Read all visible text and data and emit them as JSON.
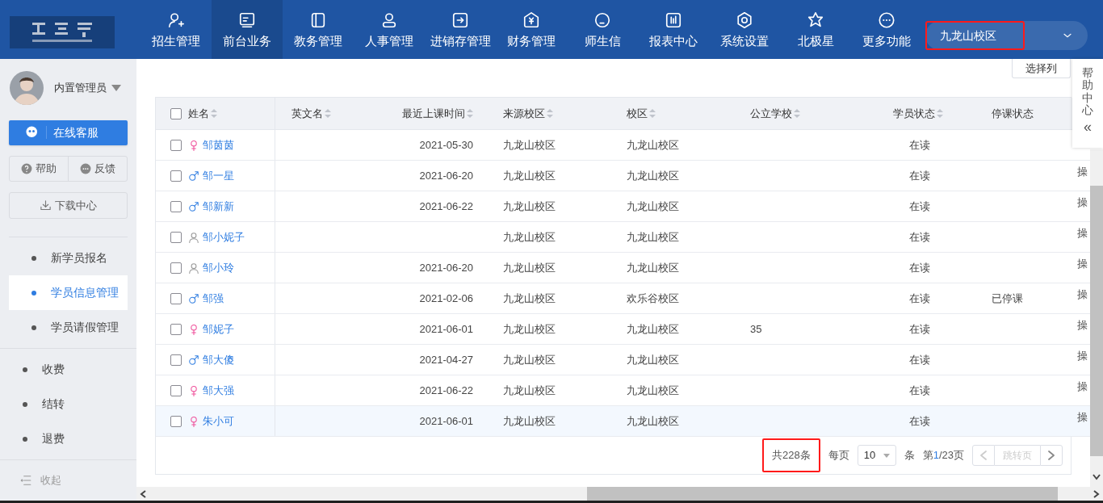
{
  "nav": {
    "items": [
      {
        "label": "招生管理",
        "selected": false
      },
      {
        "label": "前台业务",
        "selected": true
      },
      {
        "label": "教务管理",
        "selected": false
      },
      {
        "label": "人事管理",
        "selected": false
      },
      {
        "label": "进销存管理",
        "selected": false
      },
      {
        "label": "财务管理",
        "selected": false
      },
      {
        "label": "师生信",
        "selected": false
      },
      {
        "label": "报表中心",
        "selected": false
      },
      {
        "label": "系统设置",
        "selected": false
      },
      {
        "label": "北极星",
        "selected": false
      },
      {
        "label": "更多功能",
        "selected": false
      }
    ],
    "campus_select": {
      "value": "九龙山校区",
      "highlighted": true
    }
  },
  "sidebar": {
    "user": "内置管理员",
    "online_service": "在线客服",
    "help": "帮助",
    "feedback": "反馈",
    "download": "下载中心",
    "menu_groups": [
      [
        {
          "label": "新学员报名",
          "selected": false
        },
        {
          "label": "学员信息管理",
          "selected": true
        },
        {
          "label": "学员请假管理",
          "selected": false
        }
      ],
      [
        {
          "label": "收费",
          "selected": false
        },
        {
          "label": "结转",
          "selected": false
        },
        {
          "label": "退费",
          "selected": false
        }
      ]
    ],
    "collapse": "收起"
  },
  "toolbar": {
    "choose_columns": "选择列"
  },
  "help_center": {
    "label": "帮助中心",
    "icon_text": "«"
  },
  "table": {
    "all_checked": false,
    "columns": [
      {
        "label": "姓名",
        "sortable": true
      },
      {
        "label": "英文名",
        "sortable": true
      },
      {
        "label": "最近上课时间",
        "sortable": true
      },
      {
        "label": "来源校区",
        "sortable": true
      },
      {
        "label": "校区",
        "sortable": true
      },
      {
        "label": "公立学校",
        "sortable": true
      },
      {
        "label": "学员状态",
        "sortable": true
      },
      {
        "label": "停课状态",
        "sortable": false
      }
    ],
    "rows": [
      {
        "kind": "female",
        "name": "邹茵茵",
        "last_class": "2021-05-30",
        "source_campus": "九龙山校区",
        "campus": "九龙山校区",
        "status": "在读",
        "checked": false,
        "highlighted": false
      },
      {
        "kind": "male",
        "name": "邹一星",
        "last_class": "2021-06-20",
        "source_campus": "九龙山校区",
        "campus": "九龙山校区",
        "status": "在读",
        "action": "操",
        "checked": false,
        "highlighted": false
      },
      {
        "kind": "male",
        "name": "邹新新",
        "last_class": "2021-06-22",
        "source_campus": "九龙山校区",
        "campus": "九龙山校区",
        "status": "在读",
        "action": "操",
        "checked": false,
        "highlighted": false
      },
      {
        "kind": "unknown",
        "name": "邹小妮子",
        "source_campus": "九龙山校区",
        "campus": "九龙山校区",
        "status": "在读",
        "action": "操",
        "checked": false,
        "highlighted": false
      },
      {
        "kind": "unknown",
        "name": "邹小玲",
        "last_class": "2021-06-20",
        "source_campus": "九龙山校区",
        "campus": "九龙山校区",
        "status": "在读",
        "action": "操",
        "checked": false,
        "highlighted": false
      },
      {
        "kind": "male",
        "name": "邹强",
        "last_class": "2021-02-06",
        "source_campus": "九龙山校区",
        "campus": "欢乐谷校区",
        "status": "在读",
        "suspension": "已停课",
        "action": "操",
        "checked": false,
        "highlighted": false
      },
      {
        "kind": "female",
        "name": "邹妮子",
        "last_class": "2021-06-01",
        "source_campus": "九龙山校区",
        "campus": "九龙山校区",
        "public_school": "35",
        "status": "在读",
        "action": "操",
        "checked": false,
        "highlighted": false
      },
      {
        "kind": "male",
        "name": "邹大傻",
        "last_class": "2021-04-27",
        "source_campus": "九龙山校区",
        "campus": "九龙山校区",
        "status": "在读",
        "action": "操",
        "checked": false,
        "highlighted": false
      },
      {
        "kind": "female",
        "name": "邹大强",
        "last_class": "2021-06-22",
        "source_campus": "九龙山校区",
        "campus": "九龙山校区",
        "status": "在读",
        "action": "操",
        "checked": false,
        "highlighted": false
      },
      {
        "kind": "female",
        "name": "朱小可",
        "last_class": "2021-06-01",
        "source_campus": "九龙山校区",
        "campus": "九龙山校区",
        "status": "在读",
        "action": "操",
        "checked": false,
        "highlighted": true
      }
    ]
  },
  "pagination": {
    "total": "共228条",
    "total_highlighted": true,
    "per_page_label": "每页",
    "per_page": "10",
    "per_page_unit": "条",
    "page_prefix": "第",
    "current_page": "1",
    "page_suffix": "/23页",
    "jump_placeholder": "跳转页"
  }
}
